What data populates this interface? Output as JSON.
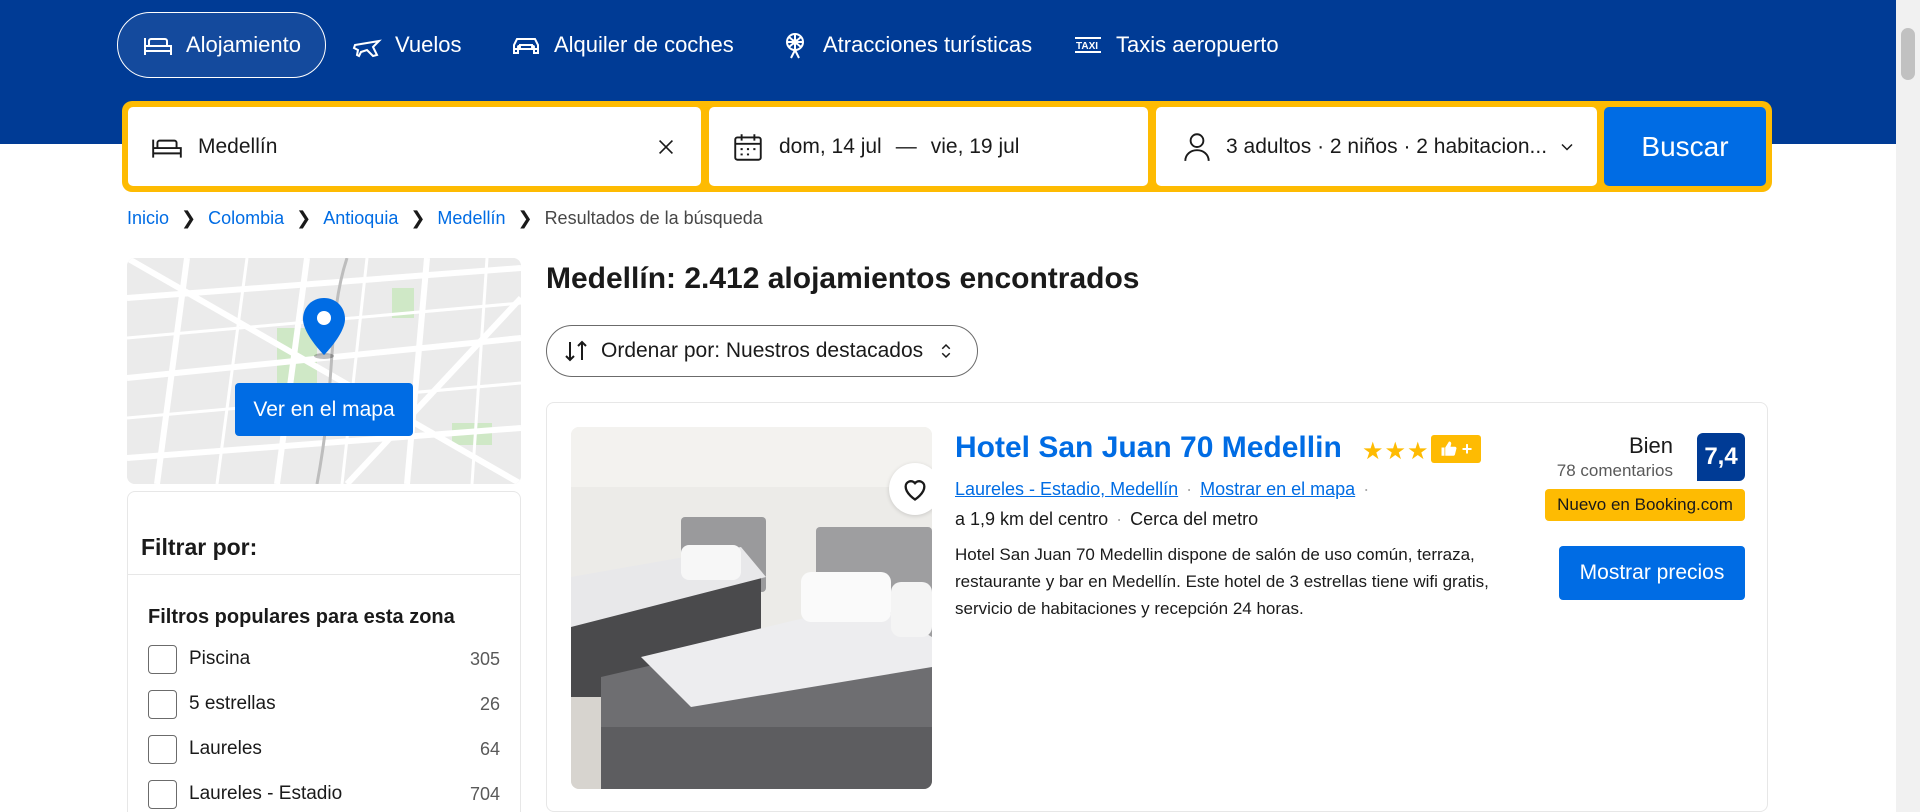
{
  "nav": {
    "tabs": [
      {
        "label": "Alojamiento",
        "icon": "bed-icon",
        "active": true
      },
      {
        "label": "Vuelos",
        "icon": "plane-icon"
      },
      {
        "label": "Alquiler de coches",
        "icon": "car-icon"
      },
      {
        "label": "Atracciones turísticas",
        "icon": "attractions-icon"
      },
      {
        "label": "Taxis aeropuerto",
        "icon": "taxi-icon"
      }
    ]
  },
  "search": {
    "destination": "Medellín",
    "checkin": "dom, 14 jul",
    "dash": "—",
    "checkout": "vie, 19 jul",
    "guests": "3 adultos · 2 niños · 2 habitacion...",
    "button_label": "Buscar"
  },
  "breadcrumb": {
    "items": [
      "Inicio",
      "Colombia",
      "Antioquia",
      "Medellín"
    ],
    "current": "Resultados de la búsqueda"
  },
  "map": {
    "button_label": "Ver en el mapa"
  },
  "filters": {
    "title": "Filtrar por:",
    "section_title": "Filtros populares para esta zona",
    "items": [
      {
        "label": "Piscina",
        "count": "305"
      },
      {
        "label": "5 estrellas",
        "count": "26"
      },
      {
        "label": "Laureles",
        "count": "64"
      },
      {
        "label": "Laureles - Estadio",
        "count": "704"
      }
    ]
  },
  "results": {
    "heading": "Medellín: 2.412 alojamientos encontrados",
    "sort_label": "Ordenar por: Nuestros destacados"
  },
  "hotel": {
    "name": "Hotel San Juan 70 Medellin",
    "stars": "★★★",
    "location_link": "Laureles - Estadio, Medellín",
    "map_link": "Mostrar en el mapa",
    "distance": "a 1,9 km del centro",
    "metro": "Cerca del metro",
    "description": "Hotel San Juan 70 Medellin dispone de salón de uso común, terraza, restaurante y bar en Medellín. Este hotel de 3 estrellas tiene wifi gratis, servicio de habitaciones y recepción 24 horas.",
    "rating_word": "Bien",
    "review_count": "78 comentarios",
    "score": "7,4",
    "badge": "Nuevo en Booking.com",
    "price_button": "Mostrar precios"
  },
  "colors": {
    "brand": "#003b95",
    "accent": "#006ce4",
    "highlight": "#febb02"
  }
}
